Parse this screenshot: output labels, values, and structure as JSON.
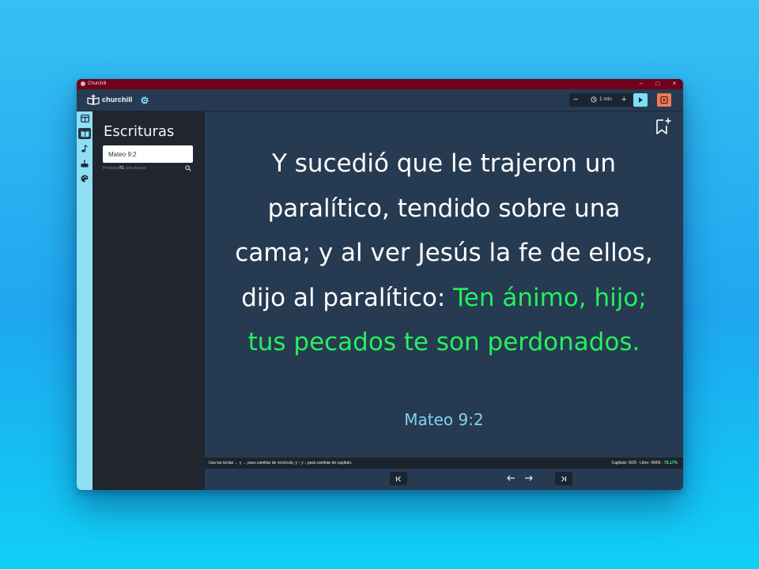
{
  "window": {
    "title": "Churchill"
  },
  "toolbar": {
    "brand": "churchill",
    "timer_duration": "1 min",
    "minus": "−",
    "plus": "+"
  },
  "scriptures": {
    "title": "Escrituras",
    "search_value": "Mateo 9:2",
    "hint_pre": "Presiona ",
    "hint_key": "F1",
    "hint_post": " para buscar."
  },
  "verse": {
    "text": "Y sucedió que le trajeron un paralítico, tendido sobre una cama; y al ver Jesús la fe de ellos, dijo al paralítico: ",
    "words_of_jesus": "Ten ánimo, hijo; tus pecados te son perdonados.",
    "reference": "Mateo 9:2"
  },
  "status": {
    "hint": "Usa las teclas ← y → para cambiar de versículo, y ↑ y ↓ para cambiar de capítulo.",
    "position": "Capítulo: 9/28 · Libro: 40/66 · ",
    "percent": "75.17%"
  },
  "colors": {
    "titlebar": "#70001c",
    "toolbar": "#263a52",
    "rail": "#8fdff3",
    "panel": "#20252e",
    "words_of_jesus": "#25f05c",
    "reference": "#86d3ec",
    "play_button": "#7fdcf7",
    "stop_button": "#f07a56"
  },
  "icons": {
    "rail": [
      "layout-icon",
      "bible-icon",
      "music-note-icon",
      "cake-icon",
      "palette-icon"
    ],
    "toolbar": [
      "settings-gear-icon",
      "clock-icon",
      "play-icon",
      "stop-icon"
    ],
    "nav": [
      "first-icon",
      "prev-arrow-icon",
      "next-arrow-icon",
      "last-icon"
    ]
  }
}
